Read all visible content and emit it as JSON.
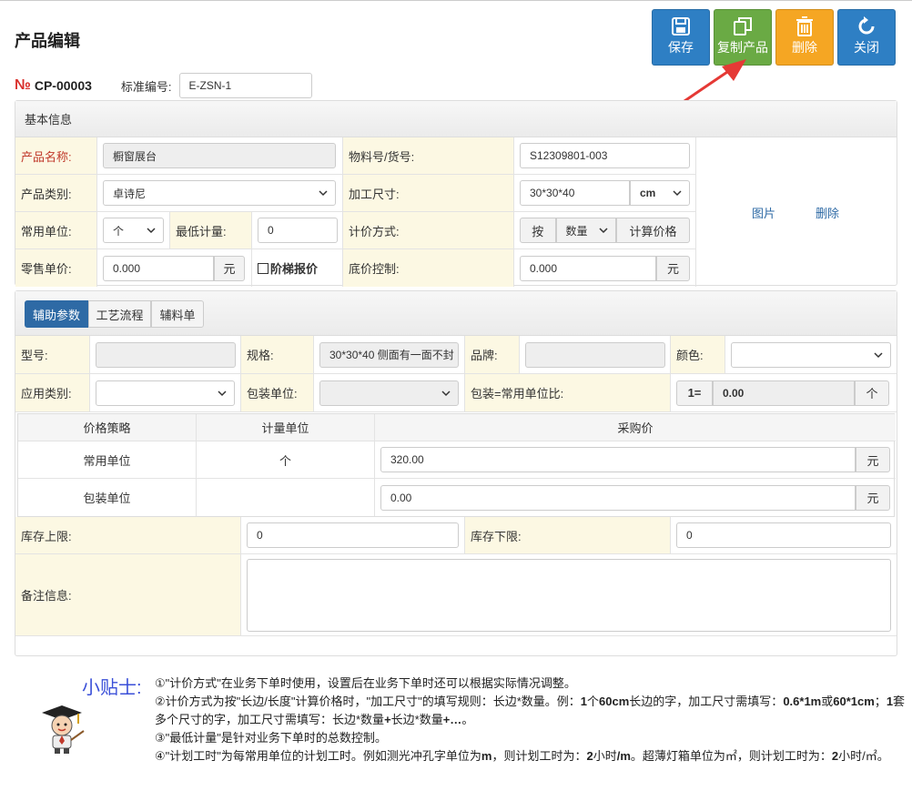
{
  "page_title": "产品编辑",
  "toolbar": {
    "save": "保存",
    "copy": "复制产品",
    "delete": "删除",
    "close": "关闭",
    "colors": {
      "save": "#2e7fc4",
      "copy": "#6aaa44",
      "delete": "#f5a623",
      "close": "#2e7fc4"
    }
  },
  "header": {
    "no_symbol": "№",
    "no_value": "CP-00003",
    "std_label": "标准编号:",
    "std_value": "E-ZSN-1"
  },
  "basic": {
    "section_title": "基本信息",
    "product_name_label": "产品名称:",
    "product_name_value": "橱窗展台",
    "material_label": "物料号/货号:",
    "material_value": "S12309801-003",
    "category_label": "产品类别:",
    "category_value": "卓诗尼",
    "size_label": "加工尺寸:",
    "size_value": "30*30*40",
    "size_unit": "cm",
    "unit_label": "常用单位:",
    "unit_value": "个",
    "min_qty_label": "最低计量:",
    "min_qty_value": "0",
    "pricing_label": "计价方式:",
    "pricing_by": "按",
    "pricing_mode": "数量",
    "pricing_calc": "计算价格",
    "retail_label": "零售单价:",
    "retail_value": "0.000",
    "yuan": "元",
    "ladder_label": "阶梯报价",
    "floor_label": "底价控制:",
    "floor_value": "0.000",
    "image_link": "图片",
    "delete_link": "删除"
  },
  "tabs": {
    "aux": "辅助参数",
    "process": "工艺流程",
    "material": "辅料单"
  },
  "aux": {
    "model_label": "型号:",
    "model_value": "",
    "spec_label": "规格:",
    "spec_value": "30*30*40  侧面有一面不封",
    "brand_label": "品牌:",
    "brand_value": "",
    "color_label": "颜色:",
    "color_value": "",
    "app_label": "应用类别:",
    "app_value": "",
    "pack_unit_label": "包装单位:",
    "pack_unit_value": "",
    "pack_ratio_label": "包装=常用单位比:",
    "pack_ratio_prefix": "1=",
    "pack_ratio_value": "0.00",
    "pack_ratio_unit": "个"
  },
  "price_table": {
    "headers": [
      "价格策略",
      "计量单位",
      "采购价"
    ],
    "rows": [
      {
        "strategy": "常用单位",
        "unit": "个",
        "price": "320.00",
        "currency": "元"
      },
      {
        "strategy": "包装单位",
        "unit": "",
        "price": "0.00",
        "currency": "元"
      }
    ]
  },
  "stock": {
    "upper_label": "库存上限:",
    "upper_value": "0",
    "lower_label": "库存下限:",
    "lower_value": "0",
    "remark_label": "备注信息:",
    "remark_value": ""
  },
  "tips": {
    "title": "小贴士:",
    "l1": "①\"计价方式\"在业务下单时使用，设置后在业务下单时还可以根据实际情况调整。",
    "l2a": "②计价方式为按\"长边/长度\"计算价格时，\"加工尺寸\"的填写规则：长边*数量。例：",
    "l2b": "1",
    "l2c": "个",
    "l2d": "60cm",
    "l2e": "长边的字，加工尺寸需填写：",
    "l2f": "0.6*1m",
    "l2g": "或",
    "l2h": "60*1cm",
    "l2i": "；",
    "l2j": "1",
    "l2k": "套多个尺寸的字，加工尺寸需填写：长边*数量",
    "l2l": "+",
    "l2m": "长边*数量",
    "l2n": "+…",
    "l2o": "。",
    "l3": "③\"最低计量\"是针对业务下单时的总数控制。",
    "l4a": "④\"计划工时\"为每常用单位的计划工时。例如测光冲孔字单位为",
    "l4b": "m",
    "l4c": "，则计划工时为：",
    "l4d": "2",
    "l4e": "小时",
    "l4f": "/m",
    "l4g": "。超薄灯箱单位为㎡，则计划工时为：",
    "l4h": "2",
    "l4i": "小时/㎡。"
  }
}
